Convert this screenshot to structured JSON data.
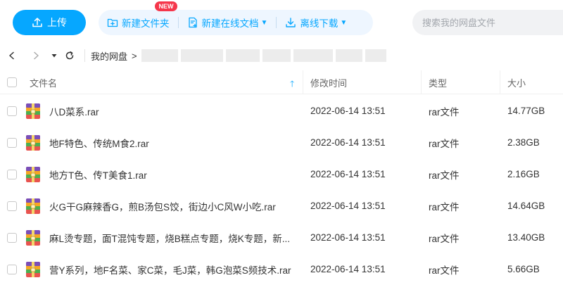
{
  "toolbar": {
    "upload_label": "上传",
    "new_folder_label": "新建文件夹",
    "new_online_doc_label": "新建在线文档",
    "new_badge": "NEW",
    "offline_download_label": "离线下载",
    "search_placeholder": "搜索我的网盘文件"
  },
  "breadcrumb": {
    "root": "我的网盘",
    "separator": ">"
  },
  "table": {
    "columns": {
      "name": "文件名",
      "modified": "修改时间",
      "type": "类型",
      "size": "大小"
    },
    "rows": [
      {
        "name": "八D菜系.rar",
        "modified": "2022-06-14 13:51",
        "type": "rar文件",
        "size": "14.77GB"
      },
      {
        "name": "地F特色、传统M食2.rar",
        "modified": "2022-06-14 13:51",
        "type": "rar文件",
        "size": "2.38GB"
      },
      {
        "name": "地方T色、传T美食1.rar",
        "modified": "2022-06-14 13:51",
        "type": "rar文件",
        "size": "2.16GB"
      },
      {
        "name": "火G干G麻辣香G，煎B汤包S饺，街边小C风W小吃.rar",
        "modified": "2022-06-14 13:51",
        "type": "rar文件",
        "size": "14.64GB"
      },
      {
        "name": "麻L烫专题，面T混饨专题，烧B糕点专题，烧K专题，新...",
        "modified": "2022-06-14 13:51",
        "type": "rar文件",
        "size": "13.40GB"
      },
      {
        "name": "营Y系列，地F名菜、家C菜，毛J菜，韩G泡菜S频技术.rar",
        "modified": "2022-06-14 13:51",
        "type": "rar文件",
        "size": "5.66GB"
      }
    ]
  },
  "colors": {
    "accent": "#06a7ff",
    "badge": "#f5374b"
  },
  "icons": {
    "upload": "upload-icon",
    "folder": "folder-plus-icon",
    "doc": "doc-plus-icon",
    "download": "download-icon",
    "file": "rar-archive-icon"
  }
}
